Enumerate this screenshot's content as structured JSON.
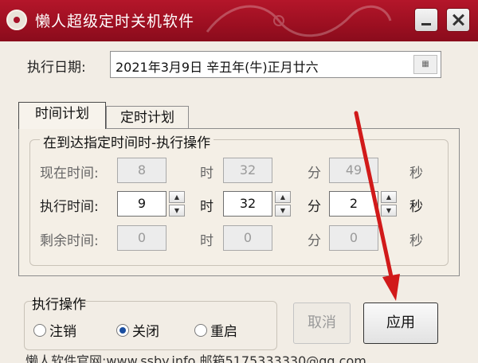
{
  "window": {
    "title": "懒人超级定时关机软件"
  },
  "date": {
    "label": "执行日期:",
    "value": "2021年3月9日  辛丑年(牛)正月廿六"
  },
  "tabs": [
    {
      "label": "时间计划"
    },
    {
      "label": "定时计划"
    }
  ],
  "schedule": {
    "group_title": "在到达指定时间时-执行操作",
    "units": {
      "hour": "时",
      "minute": "分",
      "second": "秒"
    },
    "rows": [
      {
        "label": "现在时间:",
        "hour": "8",
        "minute": "32",
        "second": "49"
      },
      {
        "label": "执行时间:",
        "hour": "9",
        "minute": "32",
        "second": "2"
      },
      {
        "label": "剩余时间:",
        "hour": "0",
        "minute": "0",
        "second": "0"
      }
    ]
  },
  "operation": {
    "title": "执行操作",
    "options": [
      "注销",
      "关闭",
      "重启"
    ],
    "selected": "关闭"
  },
  "buttons": {
    "cancel": "取消",
    "apply": "应用"
  },
  "footer": "懒人软件官网:www.ssby.info 邮箱5175333330@qq.com",
  "colors": {
    "titlebar": "#a31225",
    "annotation_arrow": "#d11a1a"
  }
}
